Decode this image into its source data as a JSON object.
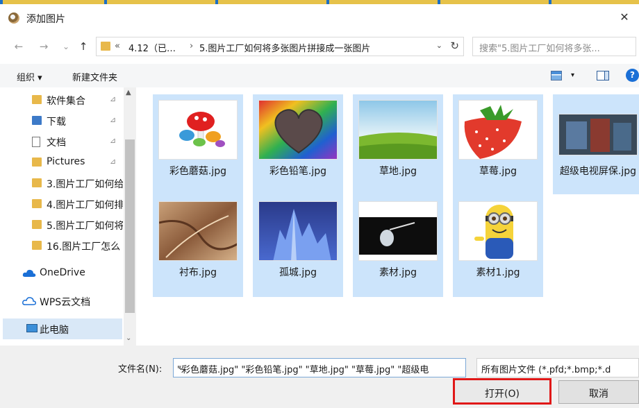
{
  "window": {
    "title": "添加图片",
    "close_glyph": "✕"
  },
  "nav": {
    "back": "←",
    "forward": "→",
    "dropdown": "⌄",
    "up": "↑"
  },
  "address": {
    "overflow": "«",
    "crumb1": "4.12（已…",
    "separator": "›",
    "crumb2": "5.图片工厂如何将多张图片拼接成一张图片",
    "dropdown": "⌄",
    "refresh": "↻"
  },
  "search": {
    "placeholder": "搜索\"5.图片工厂如何将多张..."
  },
  "toolbar": {
    "organize": "组织 ▾",
    "new_folder": "新建文件夹",
    "view_arrow": "▾",
    "help": "?"
  },
  "sidebar": {
    "items": [
      {
        "label": "软件集合",
        "pinned": true
      },
      {
        "label": "下载",
        "pinned": true
      },
      {
        "label": "文档",
        "pinned": true
      },
      {
        "label": "Pictures",
        "pinned": true
      },
      {
        "label": "3.图片工厂如何给",
        "pinned": false
      },
      {
        "label": "4.图片工厂如何排",
        "pinned": false
      },
      {
        "label": "5.图片工厂如何将",
        "pinned": false
      },
      {
        "label": "16.图片工厂怎么",
        "pinned": false
      },
      {
        "label": "OneDrive",
        "pinned": false
      },
      {
        "label": "WPS云文档",
        "pinned": false
      },
      {
        "label": "此电脑",
        "pinned": false
      }
    ],
    "pin_glyph": "📌",
    "scroll_up": "▲",
    "scroll_down": "⌄"
  },
  "files": [
    {
      "name": "彩色蘑菇.jpg"
    },
    {
      "name": "彩色铅笔.jpg"
    },
    {
      "name": "草地.jpg"
    },
    {
      "name": "草莓.jpg"
    },
    {
      "name": "超级电视屏保.jpg"
    },
    {
      "name": "衬布.jpg"
    },
    {
      "name": "孤城.jpg"
    },
    {
      "name": "素材.jpg"
    },
    {
      "name": "素材1.jpg"
    }
  ],
  "bottom": {
    "filename_label": "文件名(N):",
    "filename_value": "\"彩色蘑菇.jpg\" \"彩色铅笔.jpg\" \"草地.jpg\" \"草莓.jpg\" \"超级电",
    "filename_dropdown": "⌄",
    "filter_value": "所有图片文件 (*.pfd;*.bmp;*.d",
    "open_button": "打开(O)",
    "cancel_button": "取消"
  },
  "colors": {
    "selection": "#cce4fb",
    "folder": "#e8b84a",
    "highlight_box": "#e01818",
    "accent": "#1a6fd6"
  }
}
